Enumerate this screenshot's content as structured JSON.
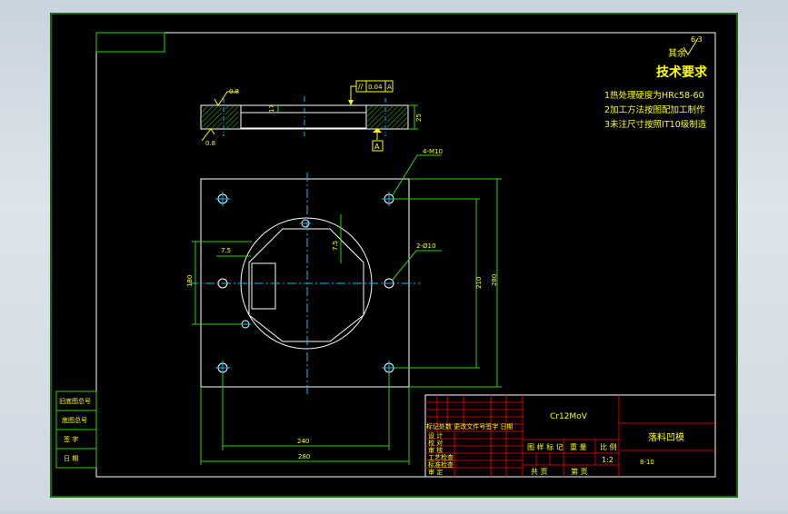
{
  "colors": {
    "background_outer": "#d3dbe3",
    "canvas": "#000000",
    "frame": "#ffffff",
    "table": "#ff0000",
    "text": "#ffff00",
    "geometry": "#ffffff",
    "dimension": "#00ff00",
    "centerline": "#00bfff"
  },
  "tech_requirements": {
    "roughness_symbol_value": "6.3",
    "roughness_label": "其余",
    "title": "技术要求",
    "item1": "1热处理硬度为HRc58-60",
    "item2": "2加工方法按图配加工制作",
    "item3": "3未注尺寸按照IT10级制造"
  },
  "section_view": {
    "roughness_top": "0.8",
    "roughness_bottom": "0.8",
    "depth_dim": "17",
    "height_dim": "25",
    "tolerance_symbol": "//",
    "tolerance_value": "0.04",
    "tolerance_datum": "A",
    "datum_label": "A"
  },
  "plan_view": {
    "hole_callout_top": "4-M10",
    "hole_callout_right": "2-Ø10",
    "dim_7_5_h": "7.5",
    "dim_7_5_v": "7.5",
    "dim_left_180": "180",
    "dim_right_210": "210",
    "dim_right_280": "280",
    "dim_bottom_240": "240",
    "dim_bottom_280": "280"
  },
  "left_sidebar": [
    "旧底图总号",
    "底图总号",
    "签 字",
    "日 期"
  ],
  "title_block": {
    "material": "Cr12MoV",
    "part_name": "落料凹模",
    "drawing_no": "8-10",
    "scale": "1:2",
    "revision_header": "标记处数 更改文件号签字 日期",
    "roles": [
      "设 计",
      "校 对",
      "审 核",
      "工艺检查",
      "标准检查",
      "审 定"
    ],
    "stage_label": "图 样 标 记",
    "weight_label": "重 量",
    "scale_label": "比 例",
    "sheets_label": "共  页",
    "sheet_label": "第  页"
  }
}
